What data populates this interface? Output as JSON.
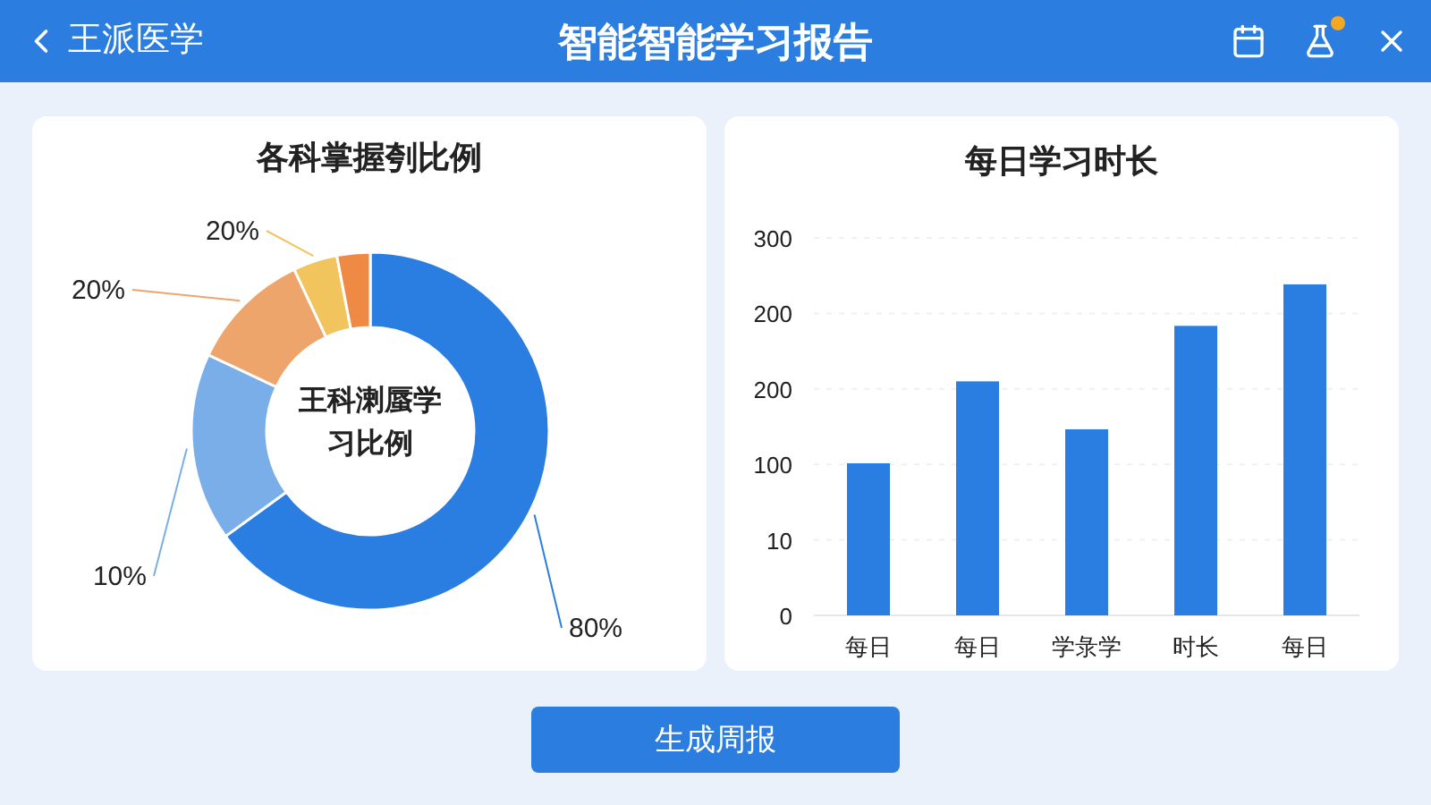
{
  "header": {
    "back_label": "王派医学",
    "title": "智能智能学习报告",
    "notification_dot": true
  },
  "donut_card": {
    "title": "各科掌握刳比例",
    "center_text": "王科溂蜃学习比例",
    "slices": [
      {
        "color": "#2a7de1",
        "label": "80%"
      },
      {
        "color": "#7aaee8",
        "label": "10%"
      },
      {
        "color": "#eda56c",
        "label": "20%"
      },
      {
        "color": "#f2c45e",
        "label": "20%"
      },
      {
        "color": "#ef8a45"
      }
    ]
  },
  "bar_card": {
    "title": "每日学习时长",
    "y_axis_labels": [
      "300",
      "200",
      "200",
      "100",
      "10",
      "0"
    ],
    "bars": [
      {
        "label": "每日"
      },
      {
        "label": "每日"
      },
      {
        "label": "学彔学"
      },
      {
        "label": "时长"
      },
      {
        "label": "每日"
      }
    ]
  },
  "button": "生成周报"
}
